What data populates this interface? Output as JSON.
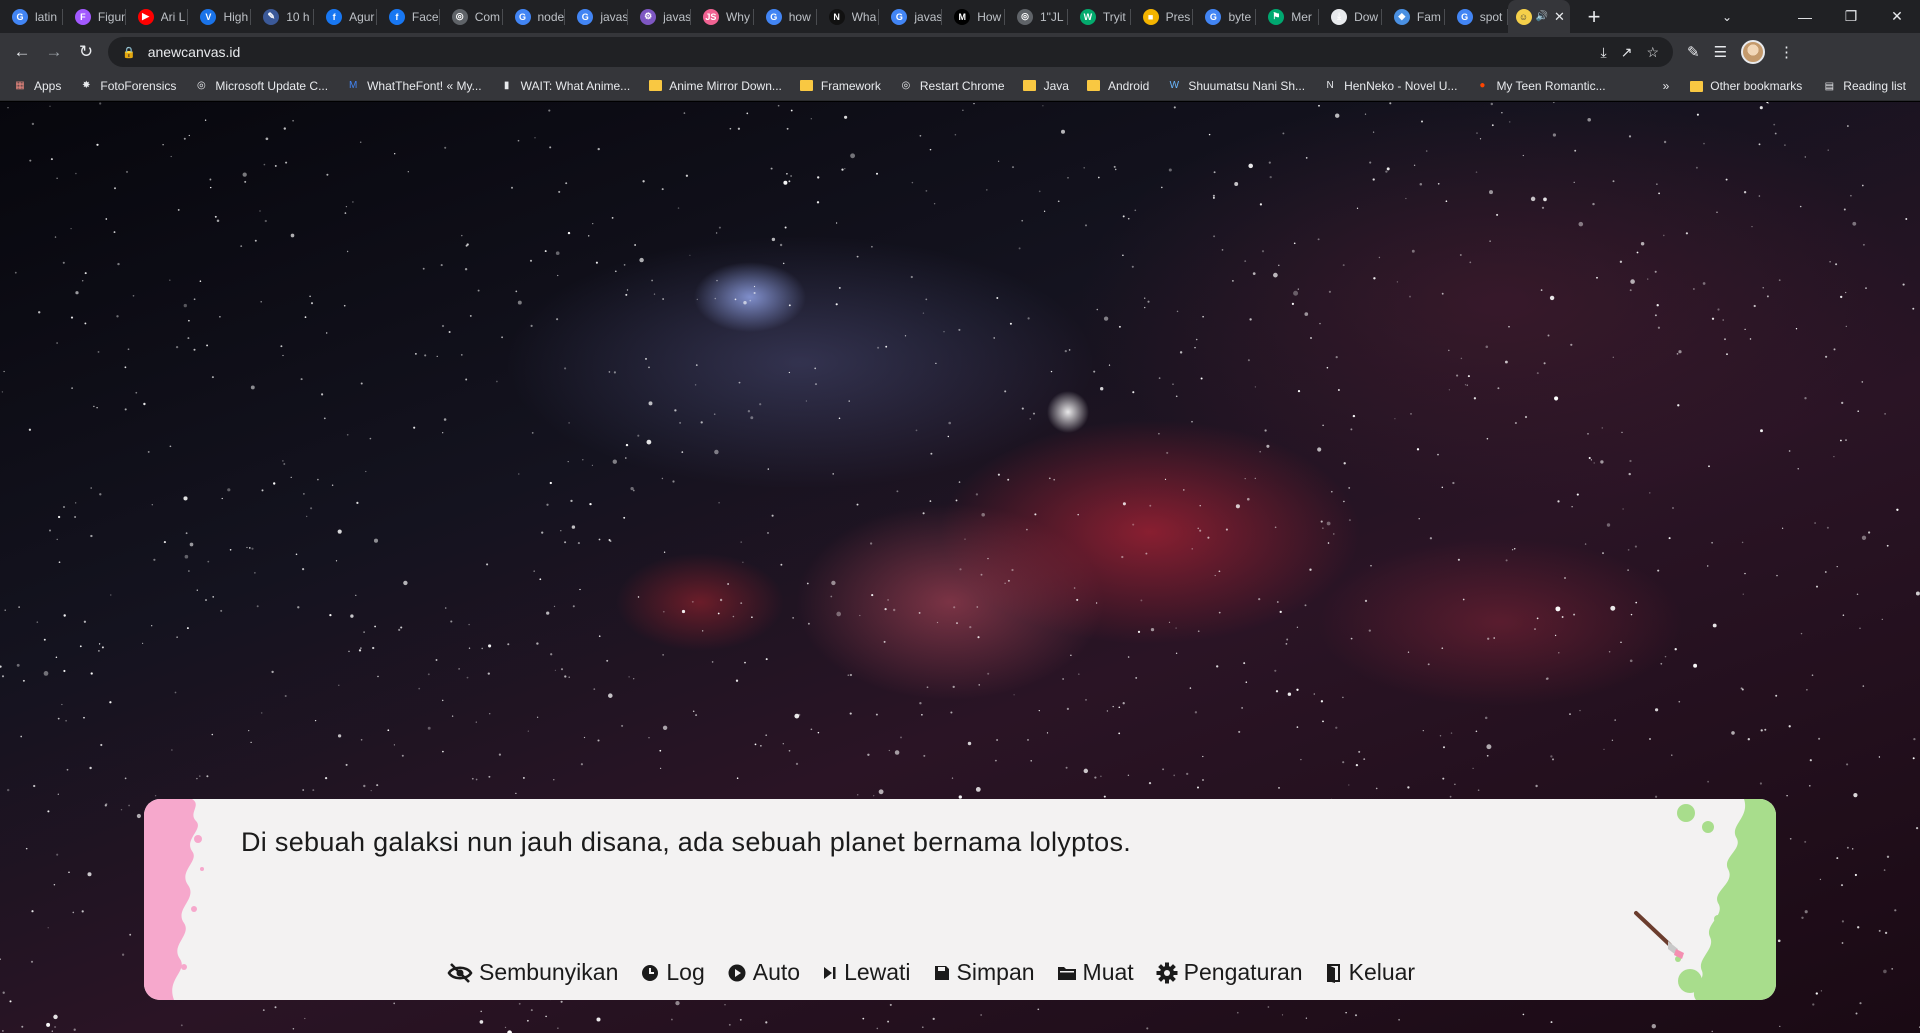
{
  "browser": {
    "tabs": [
      {
        "title": "latin",
        "icon": "google-icon",
        "color": "#4285f4"
      },
      {
        "title": "Figur",
        "icon": "figma-icon",
        "color": "#a259ff"
      },
      {
        "title": "Ari L",
        "icon": "youtube-icon",
        "color": "#ff0000"
      },
      {
        "title": "High",
        "icon": "v-icon",
        "color": "#1a73e8"
      },
      {
        "title": "10 h",
        "icon": "pen-icon",
        "color": "#3b5998"
      },
      {
        "title": "Agur",
        "icon": "facebook-icon",
        "color": "#1877f2"
      },
      {
        "title": "Face",
        "icon": "facebook-icon",
        "color": "#1877f2"
      },
      {
        "title": "Com",
        "icon": "globe-icon",
        "color": "#5f6368"
      },
      {
        "title": "node",
        "icon": "google-icon",
        "color": "#4285f4"
      },
      {
        "title": "javas",
        "icon": "google-icon",
        "color": "#4285f4"
      },
      {
        "title": "javas",
        "icon": "gear-icon",
        "color": "#7e57c2"
      },
      {
        "title": "Why",
        "icon": "js-icon",
        "color": "#f06292"
      },
      {
        "title": "how",
        "icon": "google-icon",
        "color": "#4285f4"
      },
      {
        "title": "Wha",
        "icon": "n-icon",
        "color": "#111111"
      },
      {
        "title": "javas",
        "icon": "google-icon",
        "color": "#4285f4"
      },
      {
        "title": "How",
        "icon": "medium-icon",
        "color": "#000000"
      },
      {
        "title": "1\"JL",
        "icon": "globe-icon",
        "color": "#5f6368"
      },
      {
        "title": "Tryit",
        "icon": "w3-icon",
        "color": "#04aa6d"
      },
      {
        "title": "Pres",
        "icon": "slides-icon",
        "color": "#f4b400"
      },
      {
        "title": "byte",
        "icon": "google-icon",
        "color": "#4285f4"
      },
      {
        "title": "Mer",
        "icon": "flag-icon",
        "color": "#00a870"
      },
      {
        "title": "Dow",
        "icon": "download-icon",
        "color": "#e8eaed"
      },
      {
        "title": "Fam",
        "icon": "sketch-icon",
        "color": "#4a90e2"
      },
      {
        "title": "spot",
        "icon": "google-icon",
        "color": "#4285f4"
      }
    ],
    "active_tab": {
      "title": "",
      "icon": "game-icon"
    },
    "url": "anewcanvas.id",
    "bookmarks": [
      {
        "label": "Apps",
        "icon": "apps-grid-icon"
      },
      {
        "label": "FotoForensics",
        "icon": "forensics-icon"
      },
      {
        "label": "Microsoft Update C...",
        "icon": "globe-icon"
      },
      {
        "label": "WhatTheFont! « My...",
        "icon": "myfonts-icon"
      },
      {
        "label": "WAIT: What Anime...",
        "icon": "wait-icon"
      },
      {
        "label": "Anime Mirror Down...",
        "icon": "folder-icon"
      },
      {
        "label": "Framework",
        "icon": "folder-icon"
      },
      {
        "label": "Restart Chrome",
        "icon": "globe-icon"
      },
      {
        "label": "Java",
        "icon": "folder-icon"
      },
      {
        "label": "Android",
        "icon": "folder-icon"
      },
      {
        "label": "Shuumatsu Nani Sh...",
        "icon": "wordpress-icon"
      },
      {
        "label": "HenNeko - Novel U...",
        "icon": "n-icon"
      },
      {
        "label": "My Teen Romantic...",
        "icon": "reddit-icon"
      }
    ],
    "bookmarks_more": "»",
    "other_bookmarks": "Other bookmarks",
    "reading_list": "Reading list"
  },
  "game": {
    "dialogue": "Di sebuah galaksi nun jauh disana, ada sebuah planet bernama lolyptos.",
    "menu": [
      {
        "label": "Sembunyikan",
        "icon": "eye-slash-icon"
      },
      {
        "label": "Log",
        "icon": "history-icon"
      },
      {
        "label": "Auto",
        "icon": "play-circle-icon"
      },
      {
        "label": "Lewati",
        "icon": "skip-icon"
      },
      {
        "label": "Simpan",
        "icon": "save-icon"
      },
      {
        "label": "Muat",
        "icon": "folder-open-icon"
      },
      {
        "label": "Pengaturan",
        "icon": "settings-icon"
      },
      {
        "label": "Keluar",
        "icon": "exit-icon"
      }
    ],
    "colors": {
      "pink_splat": "#f6a8cc",
      "green_splat": "#a8dd8c",
      "box_bg": "#f3f2f2"
    }
  }
}
